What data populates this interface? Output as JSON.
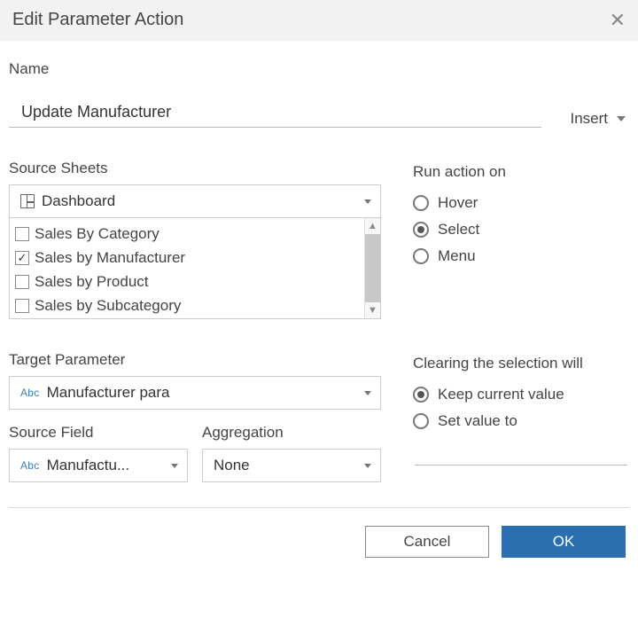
{
  "title": "Edit Parameter Action",
  "name": {
    "label": "Name",
    "value": "Update Manufacturer",
    "insert_label": "Insert"
  },
  "source_sheets": {
    "label": "Source Sheets",
    "dashboard_selected": "Dashboard",
    "sheets": [
      {
        "label": "Sales By Category",
        "checked": false
      },
      {
        "label": "Sales by Manufacturer",
        "checked": true
      },
      {
        "label": "Sales by Product",
        "checked": false
      },
      {
        "label": "Sales by Subcategory",
        "checked": false
      }
    ]
  },
  "run_on": {
    "label": "Run action on",
    "options": [
      "Hover",
      "Select",
      "Menu"
    ],
    "selected": "Select"
  },
  "target_parameter": {
    "label": "Target Parameter",
    "value": "Manufacturer para"
  },
  "source_field": {
    "label": "Source Field",
    "value": "Manufactu..."
  },
  "aggregation": {
    "label": "Aggregation",
    "value": "None"
  },
  "clearing": {
    "label": "Clearing the selection will",
    "options": [
      "Keep current value",
      "Set value to"
    ],
    "selected": "Keep current value"
  },
  "buttons": {
    "cancel": "Cancel",
    "ok": "OK"
  }
}
